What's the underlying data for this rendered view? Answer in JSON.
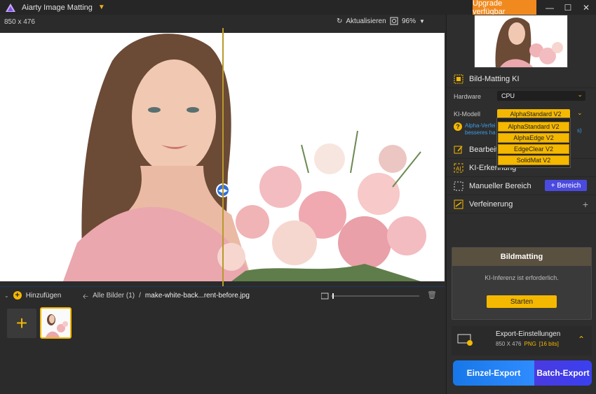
{
  "app": {
    "title": "Aiarty Image Matting",
    "upgrade_label": "Upgrade verfügbar"
  },
  "canvas": {
    "dimensions": "850 x 476",
    "refresh_label": "Aktualisieren",
    "zoom_label": "96%"
  },
  "bottom": {
    "add_label": "Hinzufügen",
    "all_images": "Alle Bilder (1)",
    "separator": "/",
    "file_name": "make-white-back...rent-before.jpg"
  },
  "panel": {
    "matting_title": "Bild-Matting KI",
    "hardware_label": "Hardware",
    "hardware_value": "CPU",
    "model_label": "KI-Modell",
    "model_value": "AlphaStandard  V2",
    "model_options": [
      "AlphaStandard  V2",
      "AlphaEdge  V2",
      "EdgeClear  V2",
      "SolidMat  V2"
    ],
    "hint_line1": "Alpha-Verfei",
    "hint_line2": "besseres ha",
    "hint_tail": "s)",
    "edit_title": "Bearbeite",
    "ki_detect_title": "KI-Erkennung",
    "manual_title": "Manueller Bereich",
    "bereich_label": "+ Bereich",
    "refine_title": "Verfeinerung",
    "bm_title": "Bildmatting",
    "bm_sub": "KI-Inferenz ist erforderlich.",
    "bm_start": "Starten",
    "export_title": "Export-Einstellungen",
    "export_dims": "850 X 476",
    "export_format": "PNG",
    "export_bits": "[16 bits]",
    "single_export": "Einzel-Export",
    "batch_export": "Batch-Export"
  },
  "colors": {
    "accent": "#f5b800",
    "upgrade": "#f08a1e",
    "single": "#1877e8",
    "batch": "#4a3ae0"
  }
}
